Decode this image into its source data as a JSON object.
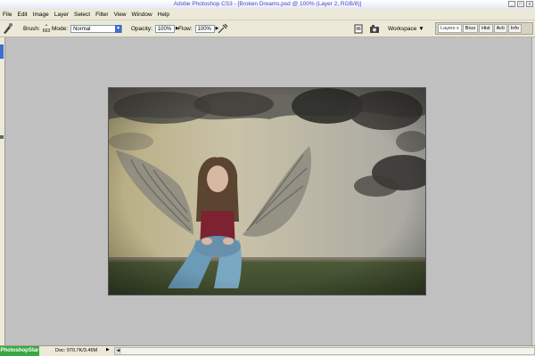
{
  "window": {
    "title": "Adobe Photoshop CS3 - [Broken Dreams.psd @ 100% (Layer 2, RGB/8)]",
    "controls": [
      "_",
      "□",
      "x"
    ]
  },
  "menu": [
    "File",
    "Edit",
    "Image",
    "Layer",
    "Select",
    "Filter",
    "View",
    "Window",
    "Help"
  ],
  "options": {
    "brush_label": "Brush:",
    "brush_size": "663",
    "mode_label": "Mode:",
    "mode_value": "Normal",
    "opacity_label": "Opacity:",
    "opacity_value": "100%",
    "flow_label": "Flow:",
    "flow_value": "100%",
    "workspace_label": "Workspace ▼"
  },
  "palette_well": {
    "tabs": [
      "Layers",
      "Brus",
      "Hist",
      "Acti",
      "Info"
    ],
    "close_glyph": "x"
  },
  "status": {
    "logo_text": "PhotoshopStar",
    "doc_info": "Doc: 970.7K/3.46M"
  },
  "colors": {
    "title_text": "#4a4ad0",
    "chrome": "#ece9d8",
    "workspace": "#c0c0c0",
    "accent_blue": "#3e6ec9",
    "status_green": "#39a843"
  }
}
